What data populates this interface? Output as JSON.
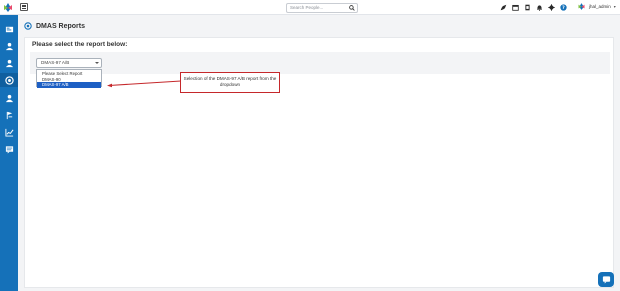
{
  "topbar": {
    "search_placeholder": "Search People...",
    "icons": [
      "rocket-icon",
      "calendar-icon",
      "clipboard-icon",
      "bell-icon",
      "gear-icon",
      "help-icon"
    ],
    "username": "jhal_admin"
  },
  "sidebar": {
    "items": [
      {
        "icon": "dashboard-icon"
      },
      {
        "icon": "person-icon"
      },
      {
        "icon": "person-icon"
      },
      {
        "icon": "reports-icon",
        "active": true
      },
      {
        "icon": "people-icon"
      },
      {
        "icon": "flag-icon"
      },
      {
        "icon": "chart-icon"
      },
      {
        "icon": "message-icon"
      }
    ]
  },
  "page": {
    "title": "DMAS Reports",
    "prompt": "Please select the report below:"
  },
  "report_select": {
    "value": "DMAS-97 A/B",
    "options": [
      "Please Select Report",
      "DMAS-90",
      "DMAS-97 A/B"
    ],
    "selected_index": 2
  },
  "callout": {
    "text": "Selection of the DMAS-97 A/B report from the dropdown"
  },
  "colors": {
    "sidebar": "#1571b9",
    "selected_option": "#1d5fc4",
    "callout_border": "#c5282b"
  }
}
